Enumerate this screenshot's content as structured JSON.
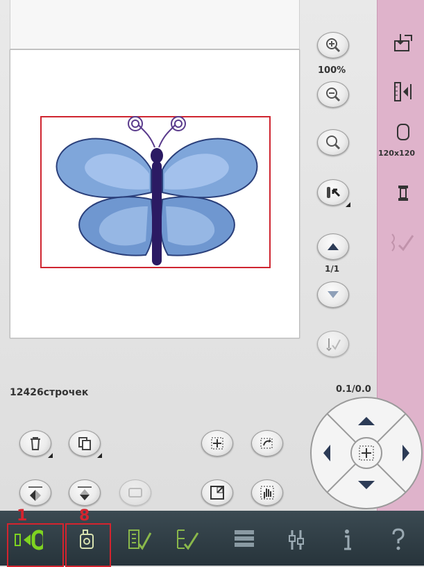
{
  "colors": {
    "accent": "#d4242e",
    "sidebar": "#dfb3cb",
    "bottombar": "#2f3d44",
    "active_icon": "#7ed321"
  },
  "zoom": {
    "level": "100%",
    "zoom_in_icon": "zoom-in-icon",
    "zoom_out_icon": "zoom-out-icon"
  },
  "page": {
    "indicator": "1/1"
  },
  "stitch_count": "12426строчек",
  "position_readout": "0.1/0.0",
  "hoop": {
    "size": "120x120"
  },
  "annotations": {
    "box1": "1",
    "box8": "8"
  },
  "icons": {
    "sidebar": [
      "load-icon",
      "stitch-meter-icon",
      "hoop-icon",
      "thread-spool-icon",
      "stitch-edit-icon"
    ],
    "bottom": [
      "embroidery-edit-icon",
      "design-preview-icon",
      "stitch-out-icon",
      "stitch-out-alt-icon",
      "color-blocks-icon",
      "settings-icon",
      "info-icon",
      "help-icon"
    ]
  }
}
